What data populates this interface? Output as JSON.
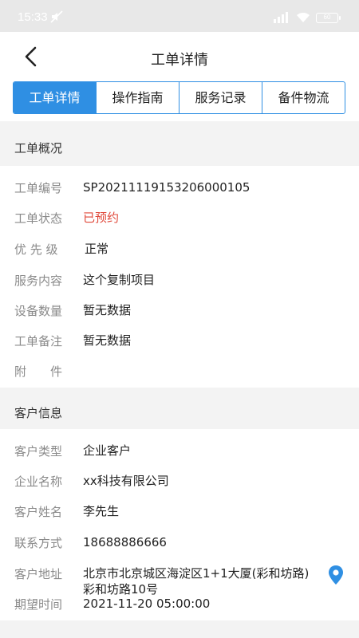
{
  "status_bar": {
    "time": "15:33",
    "battery": "60"
  },
  "navbar": {
    "title": "工单详情"
  },
  "tabs": [
    {
      "label": "工单详情",
      "active": true
    },
    {
      "label": "操作指南",
      "active": false
    },
    {
      "label": "服务记录",
      "active": false
    },
    {
      "label": "备件物流",
      "active": false
    }
  ],
  "order_overview": {
    "heading": "工单概况",
    "rows": [
      {
        "label": "工单编号",
        "value": "SP20211119153206000105"
      },
      {
        "label": "工单状态",
        "value": "已预约"
      },
      {
        "label": "优 先 级",
        "value": "正常"
      },
      {
        "label": "服务内容",
        "value": "这个复制项目"
      },
      {
        "label": "设备数量",
        "value": "暂无数据"
      },
      {
        "label": "工单备注",
        "value": "暂无数据"
      },
      {
        "label": "附　　件",
        "value": ""
      }
    ]
  },
  "customer_info": {
    "heading": "客户信息",
    "rows": [
      {
        "label": "客户类型",
        "value": "企业客户"
      },
      {
        "label": "企业名称",
        "value": "xx科技有限公司"
      },
      {
        "label": "客户姓名",
        "value": "李先生"
      },
      {
        "label": "联系方式",
        "value": "18688886666"
      },
      {
        "label": "客户地址",
        "value": "北京市北京城区海淀区1+1大厦(彩和坊路)彩和坊路10号"
      },
      {
        "label": "期望时间",
        "value": "2021-11-20 05:00:00"
      }
    ]
  },
  "colors": {
    "accent": "#2f8fe3",
    "status_red": "#e0483a",
    "location_icon": "#2f8fe3"
  }
}
